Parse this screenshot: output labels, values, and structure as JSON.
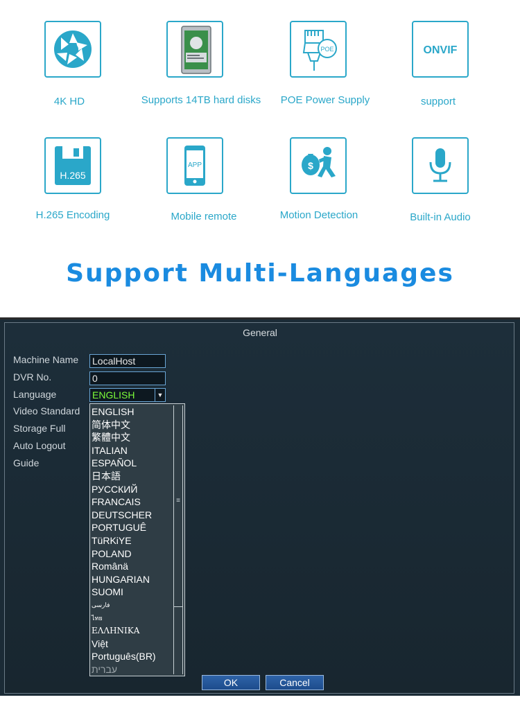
{
  "features": [
    {
      "label": "4K HD",
      "icon": "aperture-icon"
    },
    {
      "label": "Supports 14TB hard disks",
      "icon": "hard-disk-icon"
    },
    {
      "label": "POE Power Supply",
      "icon": "poe-plug-icon",
      "icon_text": "POE"
    },
    {
      "label": "support",
      "icon": "onvif-icon",
      "icon_text": "ONVIF"
    },
    {
      "label": "H.265 Encoding",
      "icon": "floppy-icon",
      "icon_text": "H.265"
    },
    {
      "label": "Mobile remote",
      "icon": "phone-icon",
      "icon_text": "APP"
    },
    {
      "label": "Motion Detection",
      "icon": "running-thief-icon",
      "icon_text": "$"
    },
    {
      "label": "Built-in Audio",
      "icon": "microphone-icon"
    }
  ],
  "headline": "Support Multi-Languages",
  "dvr": {
    "title": "General",
    "labels": [
      "Machine Name",
      "DVR No.",
      "Language",
      "Video Standard",
      "Storage Full",
      "Auto Logout",
      "Guide"
    ],
    "machine_name": "LocalHost",
    "dvr_no": "0",
    "language": "ENGLISH",
    "languages": [
      "ENGLISH",
      "简体中文",
      "繁體中文",
      "ITALIAN",
      "ESPAÑOL",
      "日本語",
      "РУССКИЙ",
      "FRANCAIS",
      "DEUTSCHER",
      "PORTUGUÊ",
      "TüRKiYE",
      "POLAND",
      "Românä",
      "HUNGARIAN",
      "SUOMI",
      "فارسی",
      "ไทย",
      "ΕΛΛΗΝΙΚΑ",
      "Việt",
      "Português(BR)",
      "עברית"
    ],
    "ok_label": "OK",
    "cancel_label": "Cancel"
  },
  "colors": {
    "accent": "#2aa7c9",
    "headline": "#1a8be0",
    "panel": "#1b2b36",
    "selected_language": "#7cfc3a"
  }
}
